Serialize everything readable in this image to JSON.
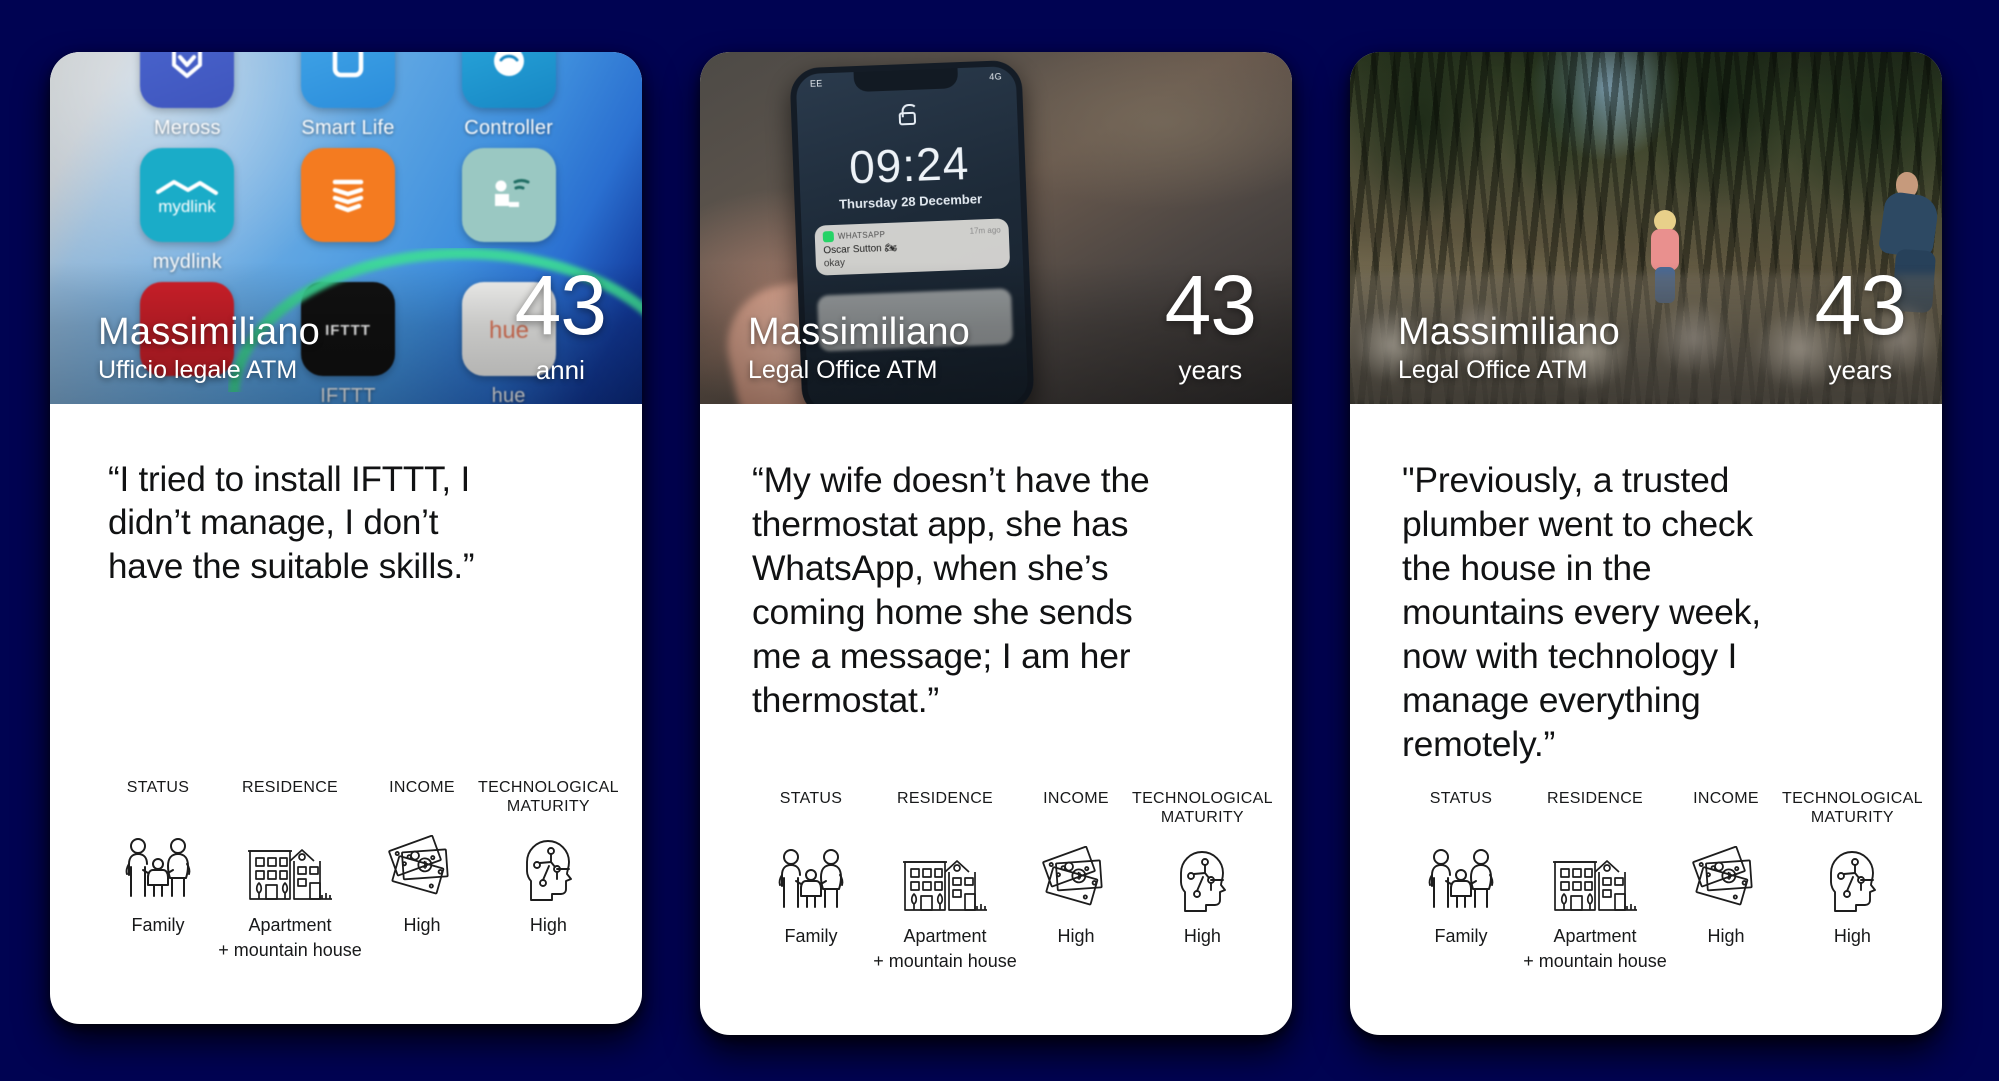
{
  "background_color": "#000352",
  "cards": [
    {
      "id": "card-italian",
      "hero_kind": "smartphone-app-grid",
      "hero_caption": "Blurred smartphone home screen showing smart-home app icons",
      "apps": [
        {
          "name": "Meross",
          "icon": "meross-app-icon"
        },
        {
          "name": "Smart Life",
          "icon": "smart-life-app-icon"
        },
        {
          "name": "Controller",
          "icon": "controller-app-icon"
        },
        {
          "name": "mydlink",
          "icon": "mydlink-app-icon"
        },
        {
          "name": "",
          "icon": "orange-app-icon"
        },
        {
          "name": "",
          "icon": "seat-sensor-app-icon"
        },
        {
          "name": "",
          "icon": "red-app-icon"
        },
        {
          "name": "IFTTT",
          "icon": "ifttt-app-icon"
        },
        {
          "name": "hue",
          "icon": "hue-app-icon"
        }
      ],
      "persona": {
        "name": "Massimiliano",
        "role": "Ufficio legale ATM",
        "age": "43",
        "age_unit": "anni"
      },
      "quote": "“I tried to install IFTTT, I\ndidn’t manage, I don’t\nhave the suitable skills.”",
      "attributes": [
        {
          "label": "STATUS",
          "icon": "family-icon",
          "value": "Family"
        },
        {
          "label": "RESIDENCE",
          "icon": "buildings-icon",
          "value": "Apartment\n+ mountain house"
        },
        {
          "label": "INCOME",
          "icon": "banknotes-icon",
          "value": "High"
        },
        {
          "label": "TECHNOLOGICAL\nMATURITY",
          "icon": "tech-head-icon",
          "value": "High"
        }
      ]
    },
    {
      "id": "card-english-phone",
      "hero_kind": "hand-holding-phone",
      "hero_caption": "Hand holding a smartphone showing its lock screen",
      "lockscreen": {
        "carrier": "EE",
        "battery": "4G",
        "time": "09:24",
        "date": "Thursday 28 December",
        "notification": {
          "app": "WHATSAPP",
          "time": "17m ago",
          "sender": "Oscar Sutton 🏍",
          "message": "okay"
        }
      },
      "persona": {
        "name": "Massimiliano",
        "role": "Legal Office ATM",
        "age": "43",
        "age_unit": "years"
      },
      "quote": "“My wife doesn’t have the\nthermostat app, she has\nWhatsApp, when she’s\ncoming home she sends\nme a message; I am her\nthermostat.”",
      "attributes": [
        {
          "label": "STATUS",
          "icon": "family-icon",
          "value": "Family"
        },
        {
          "label": "RESIDENCE",
          "icon": "buildings-icon",
          "value": "Apartment\n+ mountain house"
        },
        {
          "label": "INCOME",
          "icon": "banknotes-icon",
          "value": "High"
        },
        {
          "label": "TECHNOLOGICAL\nMATURITY",
          "icon": "tech-head-icon",
          "value": "High"
        }
      ]
    },
    {
      "id": "card-english-forest",
      "hero_kind": "forest-creek",
      "hero_caption": "A child and a man walking on rocks by a creek in a pine forest",
      "persona": {
        "name": "Massimiliano",
        "role": "Legal Office ATM",
        "age": "43",
        "age_unit": "years"
      },
      "quote": "\"Previously, a trusted\nplumber went to check\nthe house in the\nmountains every week,\nnow with technology I\nmanage everything\nremotely.”",
      "attributes": [
        {
          "label": "STATUS",
          "icon": "family-icon",
          "value": "Family"
        },
        {
          "label": "RESIDENCE",
          "icon": "buildings-icon",
          "value": "Apartment\n+ mountain house"
        },
        {
          "label": "INCOME",
          "icon": "banknotes-icon",
          "value": "High"
        },
        {
          "label": "TECHNOLOGICAL\nMATURITY",
          "icon": "tech-head-icon",
          "value": "High"
        }
      ]
    }
  ]
}
